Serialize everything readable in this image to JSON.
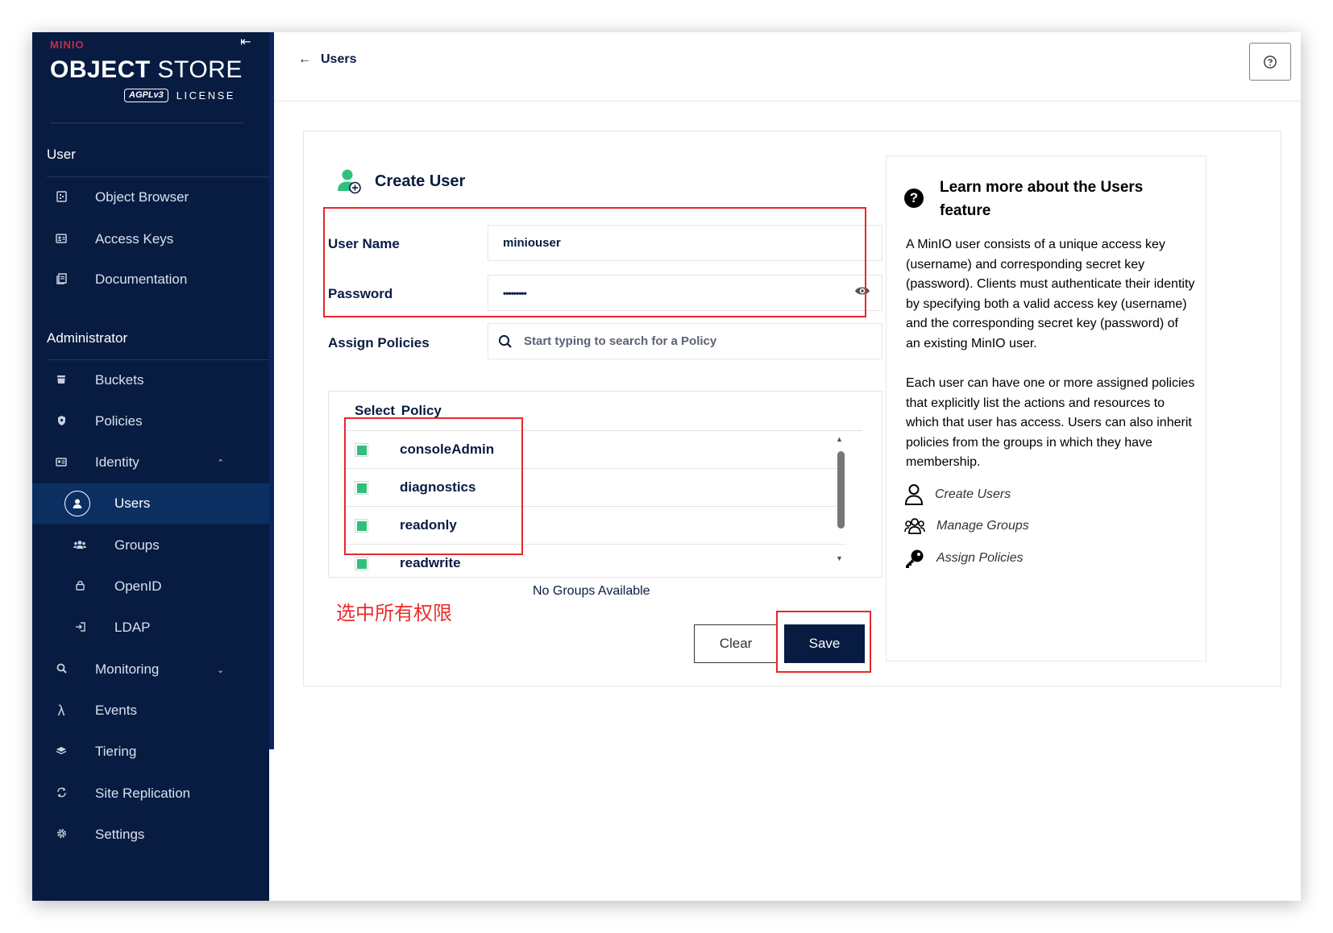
{
  "brand": {
    "minio": "MINIO",
    "title_bold": "OBJECT",
    "title_light": "STORE",
    "badge": "AGPLv3",
    "license": "LICENSE"
  },
  "sidebar": {
    "user_section": "User",
    "user_items": [
      {
        "label": "Object Browser",
        "icon": "object-browser-icon"
      },
      {
        "label": "Access Keys",
        "icon": "access-keys-icon"
      },
      {
        "label": "Documentation",
        "icon": "documentation-icon"
      }
    ],
    "admin_section": "Administrator",
    "admin_items": [
      {
        "label": "Buckets",
        "icon": "buckets-icon"
      },
      {
        "label": "Policies",
        "icon": "policies-icon"
      },
      {
        "label": "Identity",
        "icon": "identity-icon",
        "expanded": true
      },
      {
        "label": "Users",
        "icon": "user-circle-icon",
        "active": true
      },
      {
        "label": "Groups",
        "icon": "groups-icon"
      },
      {
        "label": "OpenID",
        "icon": "lock-icon"
      },
      {
        "label": "LDAP",
        "icon": "login-icon"
      },
      {
        "label": "Monitoring",
        "icon": "monitoring-icon",
        "expanded": false
      },
      {
        "label": "Events",
        "icon": "lambda-icon"
      },
      {
        "label": "Tiering",
        "icon": "tiering-icon"
      },
      {
        "label": "Site Replication",
        "icon": "replication-icon"
      },
      {
        "label": "Settings",
        "icon": "gear-icon"
      }
    ]
  },
  "header": {
    "back_label": "Users"
  },
  "form": {
    "title": "Create User",
    "username_label": "User Name",
    "username_value": "miniouser",
    "password_label": "Password",
    "password_value": "•••••••••",
    "policies_label": "Assign Policies",
    "policies_placeholder": "Start typing to search for a Policy",
    "select_policy_header": "Select  Policy",
    "policies": [
      {
        "name": "consoleAdmin",
        "checked": true
      },
      {
        "name": "diagnostics",
        "checked": true
      },
      {
        "name": "readonly",
        "checked": true
      },
      {
        "name": "readwrite",
        "checked": true
      }
    ],
    "no_groups": "No Groups Available",
    "annotation": "选中所有权限",
    "clear_label": "Clear",
    "save_label": "Save"
  },
  "help": {
    "title": "Learn more about the Users feature",
    "para1": "A MinIO user consists of a unique access key (username) and corresponding secret key (password). Clients must authenticate their identity by specifying both a valid access key (username) and the corresponding secret key (password) of an existing MinIO user.",
    "para2": "Each user can have one or more assigned policies that explicitly list the actions and resources to which that user has access. Users can also inherit policies from the groups in which they have membership.",
    "links": [
      {
        "label": "Create Users",
        "icon": "person-icon"
      },
      {
        "label": "Manage Groups",
        "icon": "group-icon"
      },
      {
        "label": "Assign Policies",
        "icon": "key-icon"
      }
    ]
  },
  "colors": {
    "sidebar_bg": "#081c42",
    "accent": "#081c42",
    "check_green": "#2fc07a",
    "highlight_red": "#e8262b"
  }
}
